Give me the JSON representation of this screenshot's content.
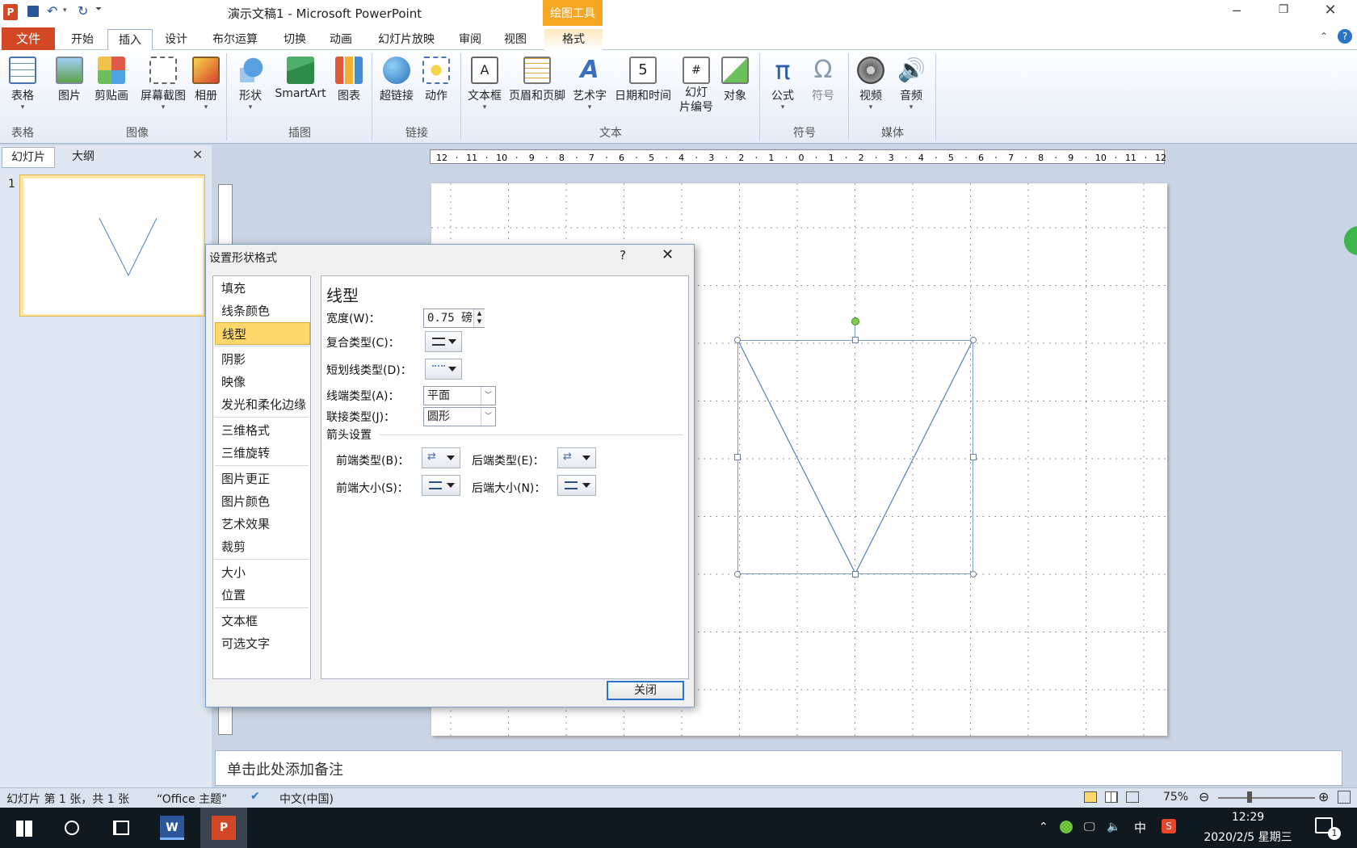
{
  "title_bar": {
    "title": "演示文稿1 - Microsoft PowerPoint",
    "context_tool": "绘图工具"
  },
  "menu": {
    "file": "文件",
    "tabs": [
      "开始",
      "插入",
      "设计",
      "布尔运算",
      "切换",
      "动画",
      "幻灯片放映",
      "审阅",
      "视图"
    ],
    "active": "插入",
    "context_tab": "格式"
  },
  "ribbon": {
    "buttons": [
      {
        "label": "表格",
        "icon": "table-icon",
        "dropdown": true
      },
      {
        "label": "图片",
        "icon": "picture-icon"
      },
      {
        "label": "剪贴画",
        "icon": "clipart-icon"
      },
      {
        "label": "屏幕截图",
        "icon": "screenshot-icon",
        "dropdown": true
      },
      {
        "label": "相册",
        "icon": "photo-album-icon",
        "dropdown": true
      },
      {
        "label": "形状",
        "icon": "shapes-icon",
        "dropdown": true
      },
      {
        "label": "SmartArt",
        "icon": "smartart-icon"
      },
      {
        "label": "图表",
        "icon": "chart-icon"
      },
      {
        "label": "超链接",
        "icon": "hyperlink-icon"
      },
      {
        "label": "动作",
        "icon": "action-icon"
      },
      {
        "label": "文本框",
        "icon": "textbox-icon",
        "dropdown": true
      },
      {
        "label": "页眉和页脚",
        "icon": "header-footer-icon"
      },
      {
        "label": "艺术字",
        "icon": "wordart-icon",
        "dropdown": true
      },
      {
        "label": "日期和时间",
        "icon": "datetime-icon"
      },
      {
        "label": "幻灯\n片编号",
        "icon": "slide-number-icon"
      },
      {
        "label": "对象",
        "icon": "object-icon"
      },
      {
        "label": "公式",
        "icon": "equation-icon",
        "dropdown": true
      },
      {
        "label": "符号",
        "icon": "symbol-icon"
      },
      {
        "label": "视频",
        "icon": "video-icon",
        "dropdown": true
      },
      {
        "label": "音频",
        "icon": "audio-icon",
        "dropdown": true
      }
    ],
    "groups": [
      "表格",
      "图像",
      "插图",
      "链接",
      "文本",
      "符号",
      "媒体"
    ]
  },
  "left_panel": {
    "tabs": [
      "幻灯片",
      "大纲"
    ],
    "slide_number": "1"
  },
  "ruler": {
    "labels": [
      "12",
      "11",
      "10",
      "9",
      "8",
      "7",
      "6",
      "5",
      "4",
      "3",
      "2",
      "1",
      "0",
      "1",
      "2",
      "3",
      "4",
      "5",
      "6",
      "7",
      "8",
      "9",
      "10",
      "11",
      "12"
    ]
  },
  "dialog": {
    "title": "设置形状格式",
    "help": "?",
    "categories": [
      "填充",
      "线条颜色",
      "线型",
      "阴影",
      "映像",
      "发光和柔化边缘",
      "三维格式",
      "三维旋转",
      "图片更正",
      "图片颜色",
      "艺术效果",
      "裁剪",
      "大小",
      "位置",
      "文本框",
      "可选文字"
    ],
    "selected_category": "线型",
    "section_title": "线型",
    "width_label": "宽度(W)：",
    "width_value": "0.75 磅",
    "compound_label": "复合类型(C)：",
    "dash_label": "短划线类型(D)：",
    "cap_label": "线端类型(A)：",
    "cap_value": "平面",
    "join_label": "联接类型(J)：",
    "join_value": "圆形",
    "arrow_section": "箭头设置",
    "begin_type_label": "前端类型(B)：",
    "end_type_label": "后端类型(E)：",
    "begin_size_label": "前端大小(S)：",
    "end_size_label": "后端大小(N)：",
    "close_button": "关闭"
  },
  "notes": {
    "placeholder": "单击此处添加备注"
  },
  "status": {
    "slide_info": "幻灯片 第 1 张，共 1 张",
    "theme": "“Office 主题”",
    "language": "中文(中国)",
    "zoom": "75%"
  },
  "taskbar": {
    "time": "12:29",
    "date": "2020/2/5 星期三",
    "ime": "中",
    "notification_count": "1"
  },
  "colors": {
    "accent": "#d24726",
    "context": "#f5a623",
    "shape_line": "#4f81bd",
    "selection": "#ffd86b"
  }
}
